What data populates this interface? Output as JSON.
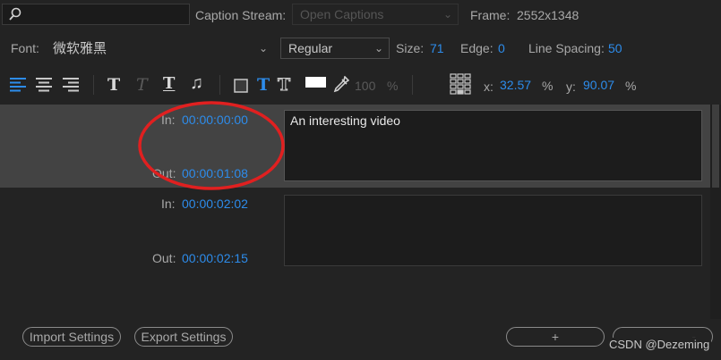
{
  "search": {
    "value": ""
  },
  "caption_stream": {
    "label": "Caption Stream:",
    "value": "Open Captions"
  },
  "frame": {
    "label": "Frame:",
    "value": "2552x1348"
  },
  "font": {
    "label": "Font:",
    "value": "微软雅黑"
  },
  "style": {
    "value": "Regular"
  },
  "size": {
    "label": "Size:",
    "value": "71"
  },
  "edge": {
    "label": "Edge:",
    "value": "0"
  },
  "line_spacing": {
    "label": "Line Spacing:",
    "value": "50"
  },
  "opacity": {
    "value": "100",
    "unit": "%"
  },
  "position": {
    "x_label": "x:",
    "x_value": "32.57",
    "x_unit": "%",
    "y_label": "y:",
    "y_value": "90.07",
    "y_unit": "%"
  },
  "captions": [
    {
      "in_label": "In:",
      "in_time": "00:00:00:00",
      "out_label": "Out:",
      "out_time": "00:00:01:08",
      "text": "An interesting video",
      "selected": true
    },
    {
      "in_label": "In:",
      "in_time": "00:00:02:02",
      "out_label": "Out:",
      "out_time": "00:00:02:15",
      "text": "",
      "selected": false
    }
  ],
  "buttons": {
    "import": "Import Settings",
    "export": "Export Settings",
    "add": "+",
    "remove": "-"
  },
  "watermark": "CSDN @Dezeming",
  "colors": {
    "accent": "#2d8ceb",
    "annotation": "#e02020",
    "background": "#232323",
    "selected_row": "#434343"
  }
}
